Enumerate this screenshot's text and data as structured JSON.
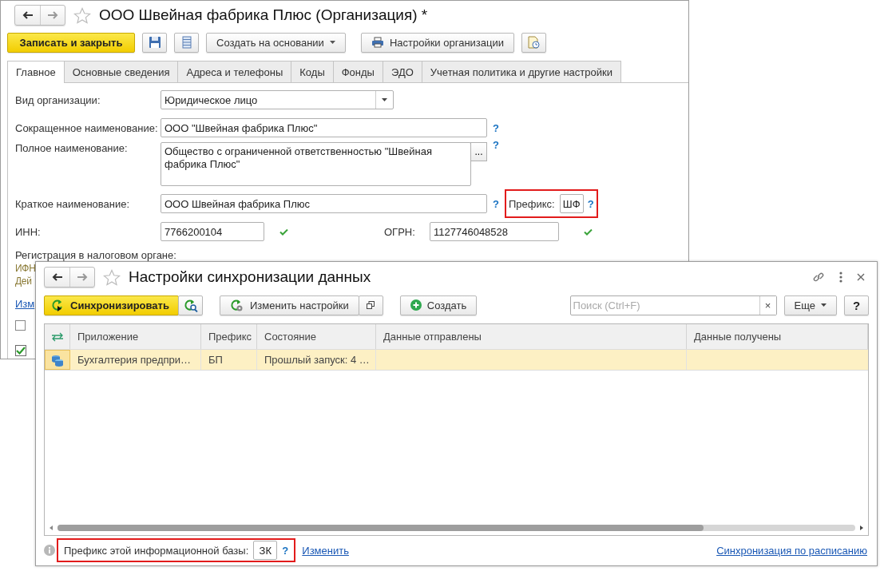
{
  "org_window": {
    "title": "ООО Швейная фабрика Плюс (Организация) *",
    "toolbar": {
      "save_close": "Записать и закрыть",
      "create_based": "Создать на основании",
      "org_settings": "Настройки организации"
    },
    "tabs": [
      {
        "label": "Главное",
        "selected": true
      },
      {
        "label": "Основные сведения",
        "selected": false
      },
      {
        "label": "Адреса и телефоны",
        "selected": false
      },
      {
        "label": "Коды",
        "selected": false
      },
      {
        "label": "Фонды",
        "selected": false
      },
      {
        "label": "ЭДО",
        "selected": false
      },
      {
        "label": "Учетная политика и другие настройки",
        "selected": false
      }
    ],
    "fields": [
      {
        "kind": "select",
        "label": "Вид организации:",
        "value": "Юридическое лицо"
      },
      {
        "kind": "text",
        "label": "Сокращенное наименование:",
        "value": "ООО \"Швейная фабрика Плюс\"",
        "help": "?"
      },
      {
        "kind": "textarea",
        "label": "Полное наименование:",
        "value": "Общество с ограниченной ответственностью \"Швейная фабрика Плюс\"",
        "button": "...",
        "help": "?"
      },
      {
        "kind": "text_prefix",
        "label": "Краткое наименование:",
        "value": "ООО Швейная фабрика Плюс",
        "help": "?",
        "prefix_label": "Префикс:",
        "prefix_value": "ШФ",
        "prefix_help": "?",
        "highlighted": true
      },
      {
        "kind": "pair",
        "label": "ИНН:",
        "value": "7766200104",
        "valid": true,
        "label2": "ОГРН:",
        "value2": "1127746048528",
        "valid2": true
      },
      {
        "kind": "caption",
        "label": "Регистрация в налоговом органе:"
      },
      {
        "kind": "note",
        "label": "ИФН"
      },
      {
        "kind": "note",
        "label": "Дей"
      },
      {
        "kind": "link",
        "label": "Изм"
      },
      {
        "kind": "checkbox",
        "checked": false
      },
      {
        "kind": "checkbox",
        "checked": true
      }
    ]
  },
  "sync_window": {
    "title": "Настройки синхронизации данных",
    "toolbar": {
      "sync": "Синхронизировать",
      "change_settings": "Изменить настройки",
      "create": "Создать",
      "search_placeholder": "Поиск (Ctrl+F)",
      "clear": "×",
      "more": "Еще",
      "help": "?"
    },
    "table": {
      "columns": [
        "Приложение",
        "Префикс",
        "Состояние",
        "Данные отправлены",
        "Данные получены"
      ],
      "rows": [
        {
          "selected": true,
          "cells": [
            "Бухгалтерия предпри…",
            "БП",
            "Прошлый запуск: 4 …"
          ]
        }
      ]
    },
    "footer": {
      "prefix_label": "Префикс этой информационной базы:",
      "prefix_value": "ЗК",
      "help": "?",
      "highlighted": true,
      "change_link": "Изменить",
      "schedule_link": "Синхронизация по расписанию"
    }
  }
}
